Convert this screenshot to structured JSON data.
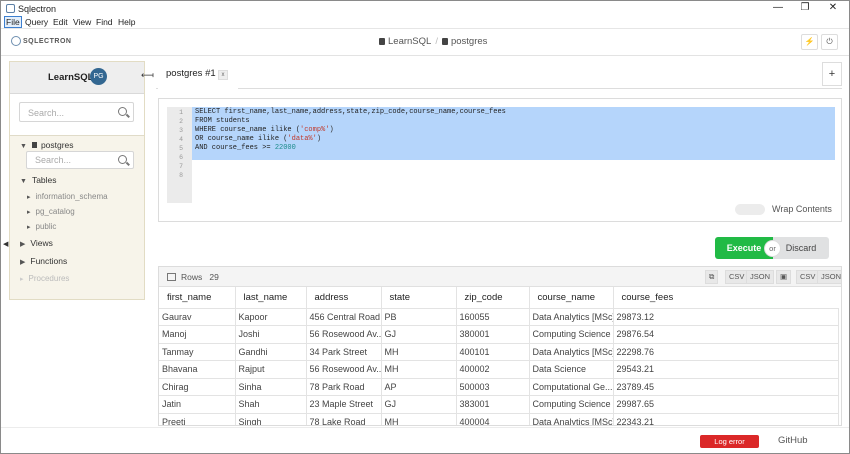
{
  "window": {
    "title": "Sqlectron",
    "minimize": "—",
    "maximize": "❐",
    "close": "✕"
  },
  "menu": [
    "File",
    "Query",
    "Edit",
    "View",
    "Find",
    "Help"
  ],
  "header": {
    "logo_text": "SQLECTRON",
    "crumb_db": "LearnSQL",
    "crumb_separator": "/",
    "crumb_schema": "postgres",
    "btn_plug": "⚡",
    "btn_power": "⏻"
  },
  "sidebar": {
    "server_name": "LearnSQL",
    "server_badge": "PG",
    "search_placeholder": "Search...",
    "db_name": "postgres",
    "db_search_placeholder": "Search...",
    "tables_label": "Tables",
    "tables": [
      "information_schema",
      "pg_catalog",
      "public"
    ],
    "views_label": "Views",
    "functions_label": "Functions",
    "procedures_label": "Procedures",
    "collapse_arrow": "⟻"
  },
  "tabs": [
    {
      "label": "postgres #1",
      "close": "x"
    }
  ],
  "add_tab": "+",
  "editor": {
    "line_numbers": [
      "1",
      "2",
      "3",
      "4",
      "5",
      "6",
      "7",
      "8"
    ],
    "lines": [
      "SELECT first_name,last_name,address,state,zip_code,course_name,course_fees",
      "FROM students",
      "WHERE course_name ilike (",
      "OR course_name ilike (",
      "AND course_fees >= ",
      "",
      "",
      ""
    ],
    "str1": "'comp%'",
    "str2": "'data%'",
    "close_paren": ")",
    "num1": "22000"
  },
  "wrap_label": "Wrap Contents",
  "execute_label": "Execute",
  "or_label": "or",
  "discard_label": "Discard",
  "results": {
    "rows_label": "Rows",
    "rows_count": "29",
    "copy_csv": "CSV",
    "copy_json": "JSON",
    "save_csv": "CSV",
    "save_json": "JSON",
    "columns": [
      "first_name",
      "last_name",
      "address",
      "state",
      "zip_code",
      "course_name",
      "course_fees"
    ],
    "rows": [
      [
        "Gaurav",
        "Kapoor",
        "456 Central Road",
        "PB",
        "160055",
        "Data Analytics [MSc]",
        "29873.12"
      ],
      [
        "Manoj",
        "Joshi",
        "56 Rosewood Av...",
        "GJ",
        "380001",
        "Computing Science",
        "29876.54"
      ],
      [
        "Tanmay",
        "Gandhi",
        "34 Park Street",
        "MH",
        "400101",
        "Data Analytics [MSc]",
        "22298.76"
      ],
      [
        "Bhavana",
        "Rajput",
        "56 Rosewood Av...",
        "MH",
        "400002",
        "Data Science",
        "29543.21"
      ],
      [
        "Chirag",
        "Sinha",
        "78 Park Road",
        "AP",
        "500003",
        "Computational Ge...",
        "23789.45"
      ],
      [
        "Jatin",
        "Shah",
        "23 Maple Street",
        "GJ",
        "383001",
        "Computing Science",
        "29987.65"
      ],
      [
        "Preeti",
        "Singh",
        "78 Lake Road",
        "MH",
        "400004",
        "Data Analytics [MSc]",
        "22343.21"
      ]
    ]
  },
  "footer": {
    "log_error": "Log   error",
    "github": "GitHub"
  }
}
